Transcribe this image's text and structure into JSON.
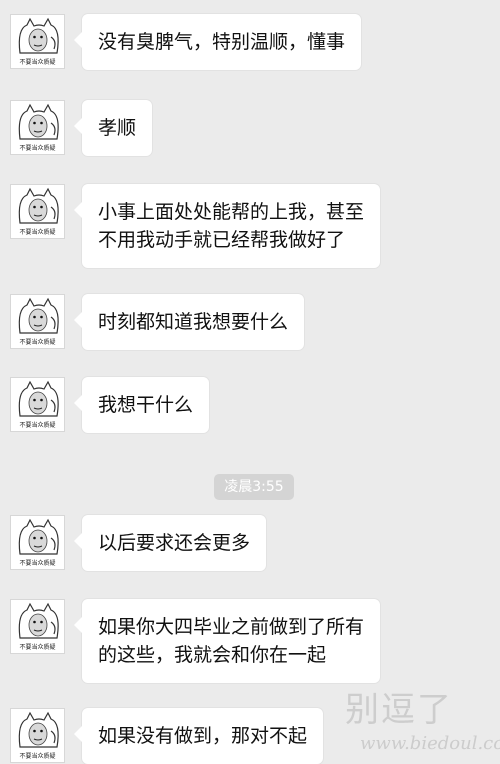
{
  "avatar": {
    "caption": "不要当众质疑",
    "icon": "cat-meme-avatar-icon"
  },
  "messages": [
    {
      "lines": [
        "没有臭脾气，特别温顺，懂事"
      ]
    },
    {
      "lines": [
        "孝顺"
      ]
    },
    {
      "lines": [
        "小事上面处处能帮的上我，甚至",
        "不用我动手就已经帮我做好了"
      ]
    },
    {
      "lines": [
        "时刻都知道我想要什么"
      ]
    },
    {
      "lines": [
        "我想干什么"
      ]
    },
    {
      "lines": [
        "以后要求还会更多"
      ]
    },
    {
      "lines": [
        "如果你大四毕业之前做到了所有",
        "的这些，我就会和你在一起"
      ]
    },
    {
      "lines": [
        "如果没有做到，那对不起"
      ]
    }
  ],
  "timestamp": "凌晨3:55",
  "watermark": {
    "text": "别逗了",
    "url": "www.biedoul.com"
  },
  "colors": {
    "background": "#ebebeb",
    "bubble": "#ffffff",
    "timestamp_bg": "#d4d4d4"
  }
}
